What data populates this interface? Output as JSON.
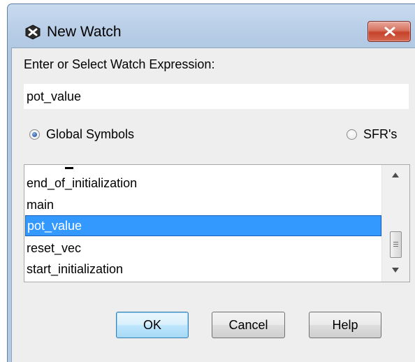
{
  "window": {
    "title": "New Watch",
    "close_icon": "close-x-icon",
    "app_icon": "watch-app-icon"
  },
  "prompt": "Enter or Select Watch Expression:",
  "expression_input": {
    "value": "pot_value"
  },
  "symbol_type": {
    "options": [
      {
        "label": "Global Symbols",
        "checked": true
      },
      {
        "label": "SFR's",
        "checked": false
      }
    ]
  },
  "symbol_list": {
    "items": [
      "end_of_initialization",
      "main",
      "pot_value",
      "reset_vec",
      "start_initialization"
    ],
    "selected": "pot_value"
  },
  "buttons": {
    "ok": "OK",
    "cancel": "Cancel",
    "help": "Help"
  },
  "colors": {
    "selection": "#3399ff",
    "close_button": "#c7412a"
  }
}
